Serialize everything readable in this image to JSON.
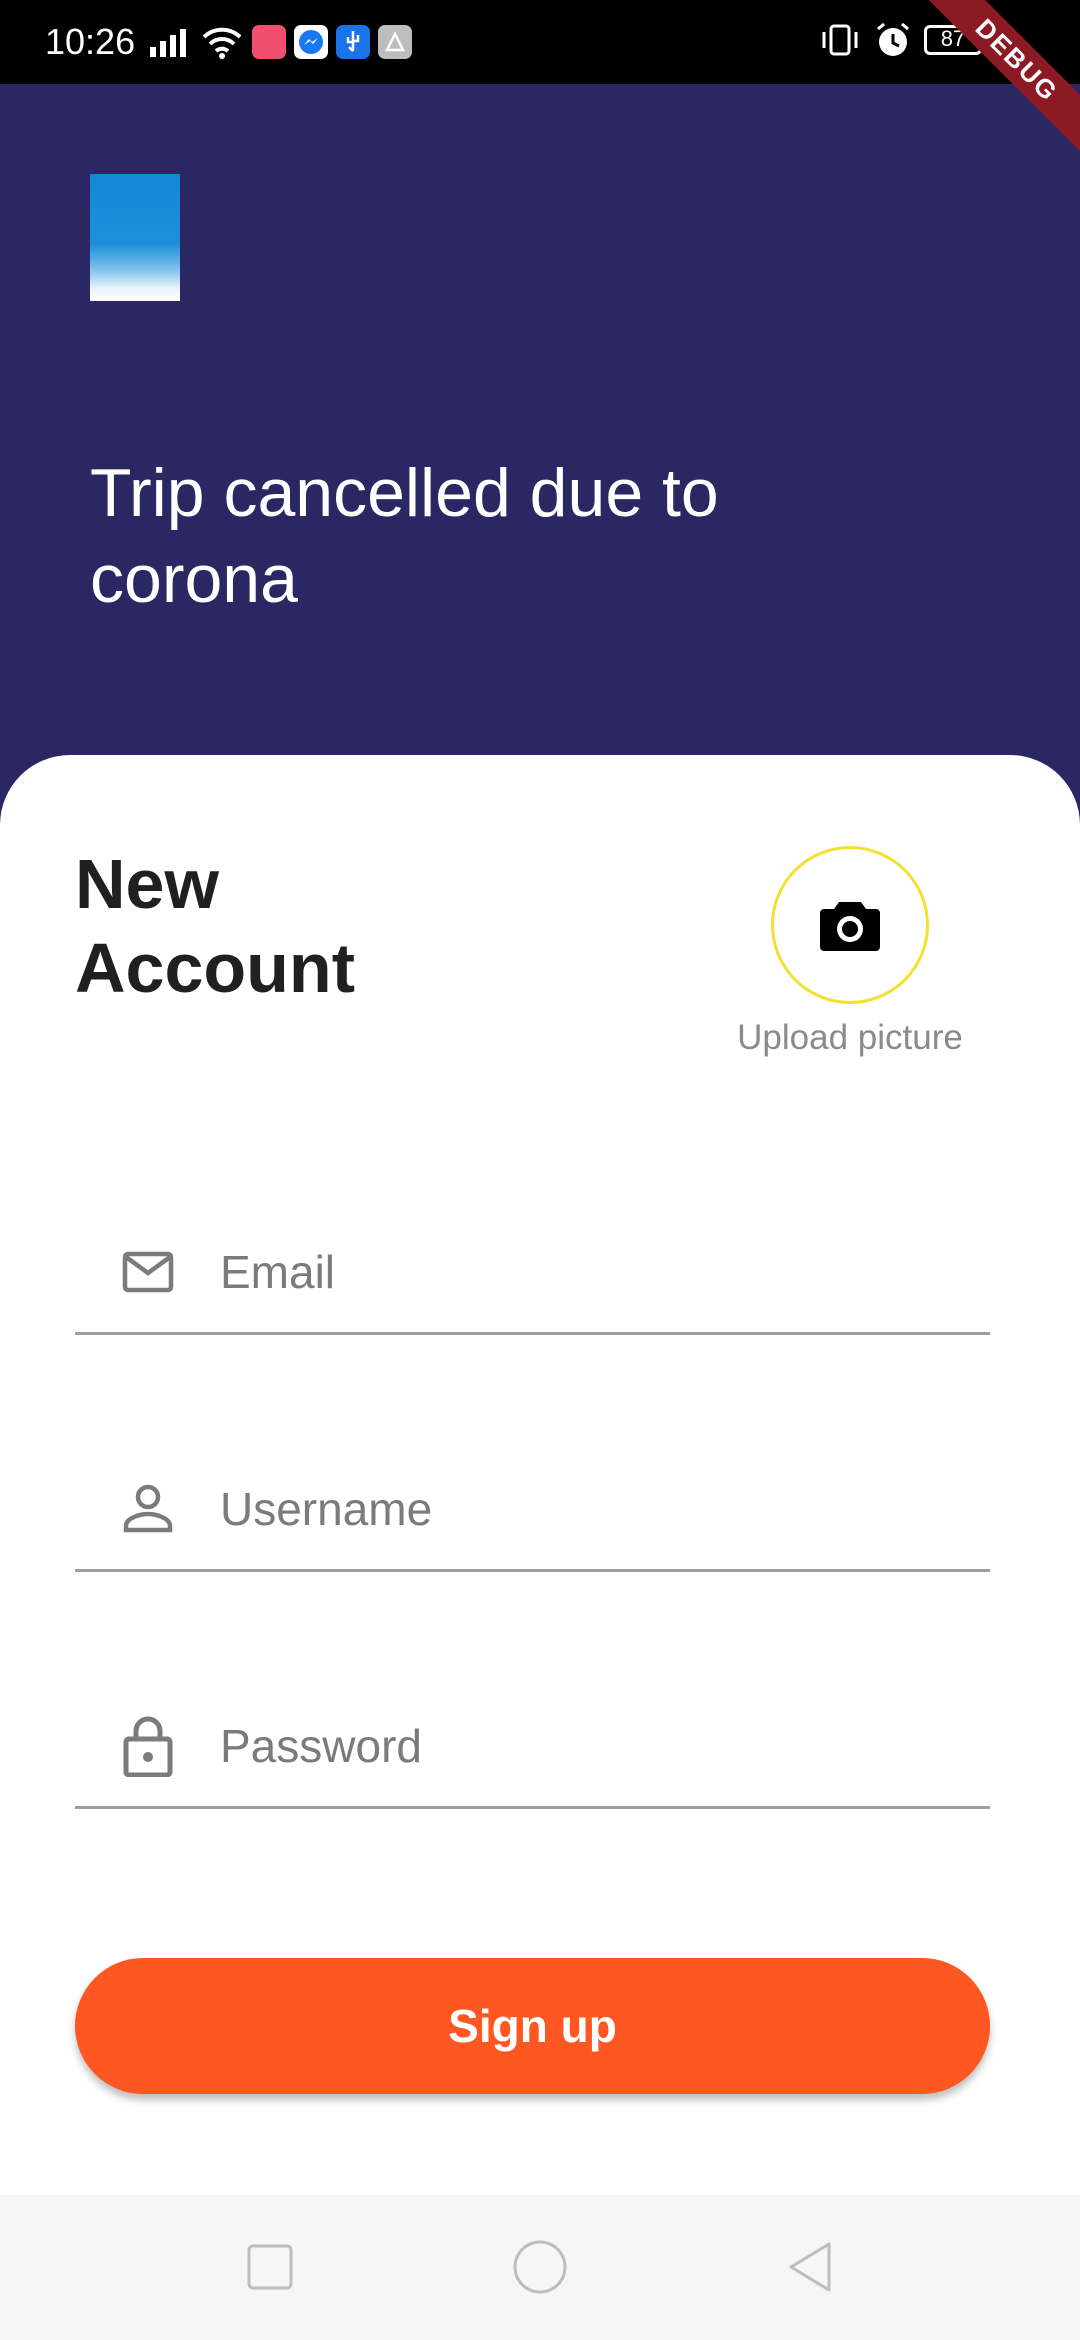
{
  "status_bar": {
    "time": "10:26",
    "battery": "87",
    "icons": [
      "signal-icon",
      "wifi-icon",
      "app-notification-icons",
      "vibrate-icon",
      "alarm-icon",
      "battery-icon",
      "charging-icon"
    ]
  },
  "debug_banner": "DEBUG",
  "header": {
    "title": "Trip cancelled due to corona"
  },
  "card": {
    "title": "New Account",
    "upload_label": "Upload picture"
  },
  "form": {
    "email_placeholder": "Email",
    "username_placeholder": "Username",
    "password_placeholder": "Password",
    "signup_label": "Sign up"
  },
  "colors": {
    "header_bg": "#2a2762",
    "accent": "#ff5722",
    "upload_ring": "#f2e033"
  }
}
